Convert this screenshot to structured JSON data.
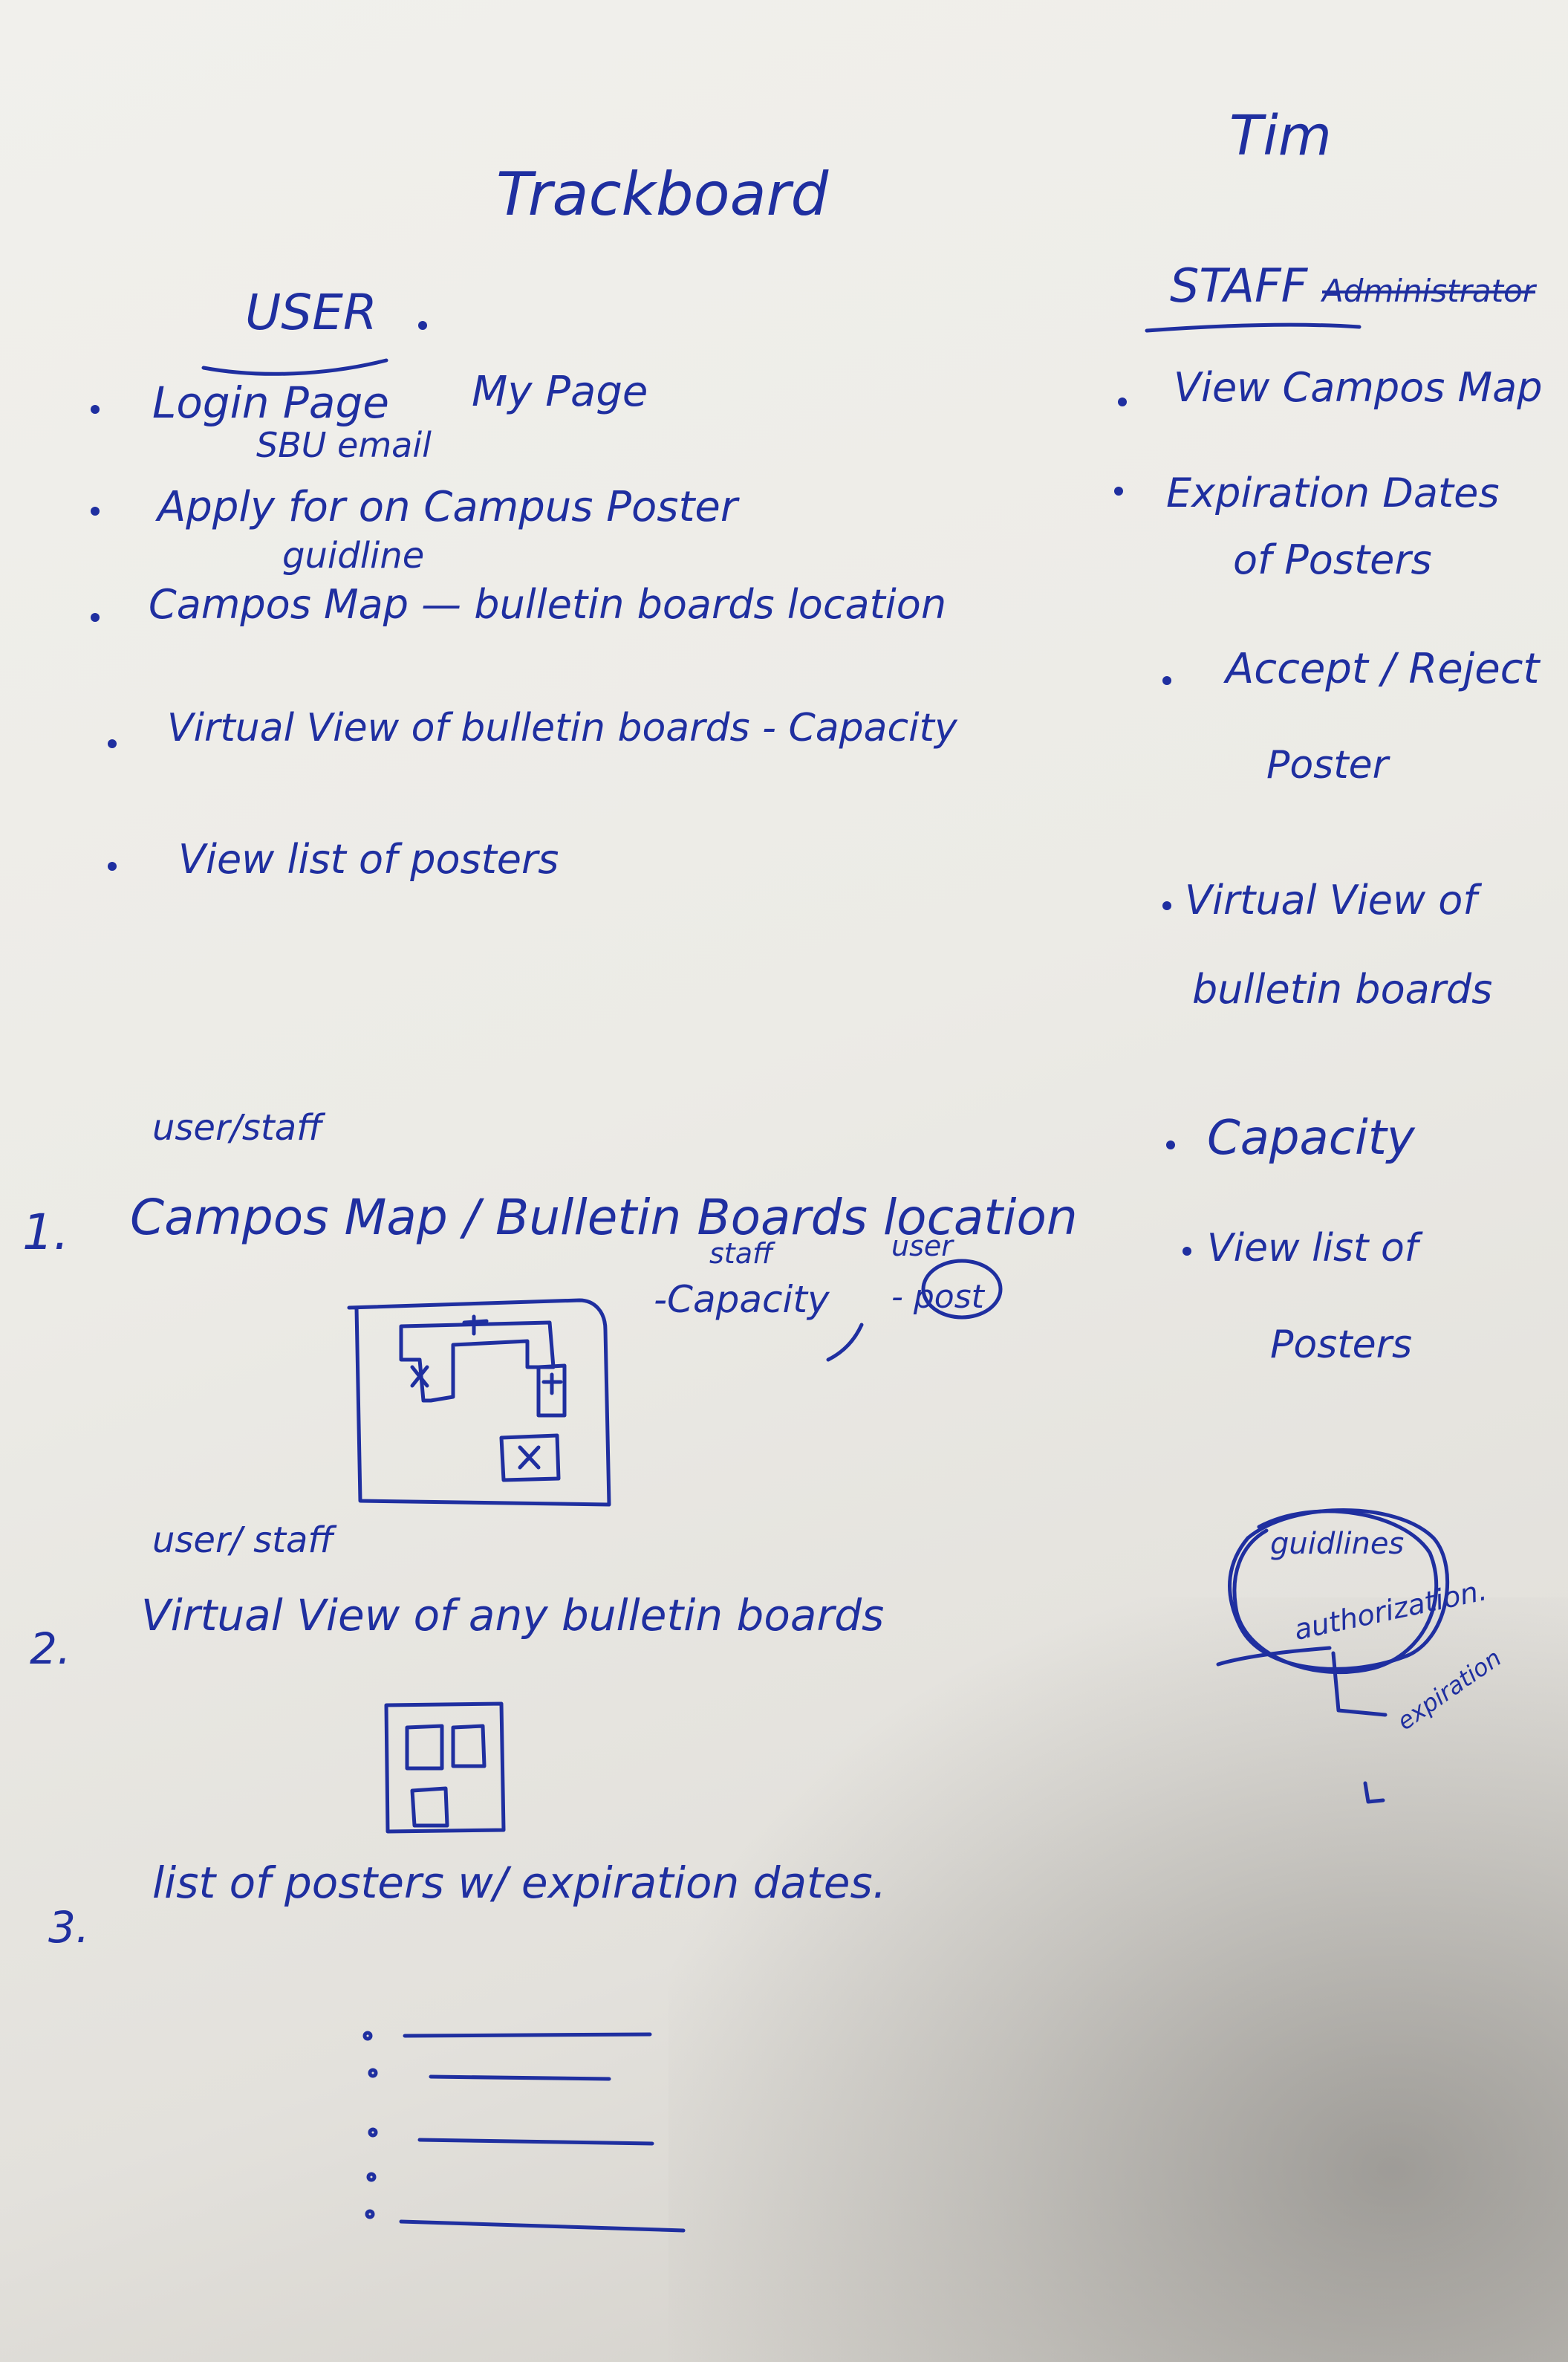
{
  "header": {
    "title": "Trackboard",
    "name": "Tim"
  },
  "user_column": {
    "heading": "USER",
    "items": [
      "Login Page",
      "My Page",
      "SBU email",
      "Apply for on Campus Poster",
      "guidline",
      "Campos Map — bulletin boards location",
      "Virtual View of bulletin boards - Capacity",
      "View list of posters"
    ]
  },
  "staff_column": {
    "heading": "STAFF",
    "heading_alt": "Administrator",
    "items": [
      "View Campos Map",
      "Expiration Dates",
      "of Posters",
      "Accept / Reject",
      "Poster",
      "Virtual View of",
      "bulletin boards",
      "Capacity",
      "View list of",
      "Posters"
    ]
  },
  "sections": [
    {
      "role": "user/staff",
      "number": "1.",
      "text": "Campos Map / Bulletin Boards location",
      "staff_note": "staff",
      "staff_detail": "-Capacity",
      "user_note": "user",
      "user_detail": "- post"
    },
    {
      "role": "user/ staff",
      "number": "2.",
      "text": "Virtual View of any bulletin boards"
    },
    {
      "number": "3.",
      "text": "list of posters w/ expiration dates."
    }
  ],
  "side_note": {
    "line1": "guidlines",
    "line2": "authorization.",
    "line3": "expiration"
  },
  "colors": {
    "ink": "#1f2fa0",
    "paper": "#eeede9"
  }
}
